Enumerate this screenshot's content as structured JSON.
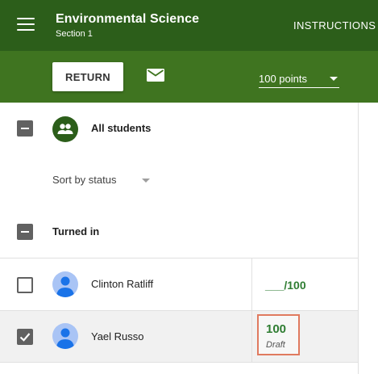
{
  "header": {
    "title": "Environmental Science",
    "subtitle": "Section 1",
    "instructions_tab": "INSTRUCTIONS"
  },
  "toolbar": {
    "return_label": "RETURN",
    "points_value": "100 points"
  },
  "roster": {
    "all_students_label": "All students",
    "sort_label": "Sort by status",
    "section_label": "Turned in",
    "students": [
      {
        "name": "Clinton Ratliff",
        "grade": "___/100",
        "checked": false
      },
      {
        "name": "Yael Russo",
        "grade": "100",
        "grade_status": "Draft",
        "checked": true
      }
    ]
  },
  "colors": {
    "header_bg": "#2c5e1a",
    "toolbar_bg": "#3f7420",
    "grade_text": "#2f7d32",
    "grade_highlight": "#e07a5f"
  },
  "icons": [
    "menu-icon",
    "email-icon",
    "people-icon",
    "dropdown-caret-icon",
    "checkbox-icon",
    "person-icon"
  ]
}
